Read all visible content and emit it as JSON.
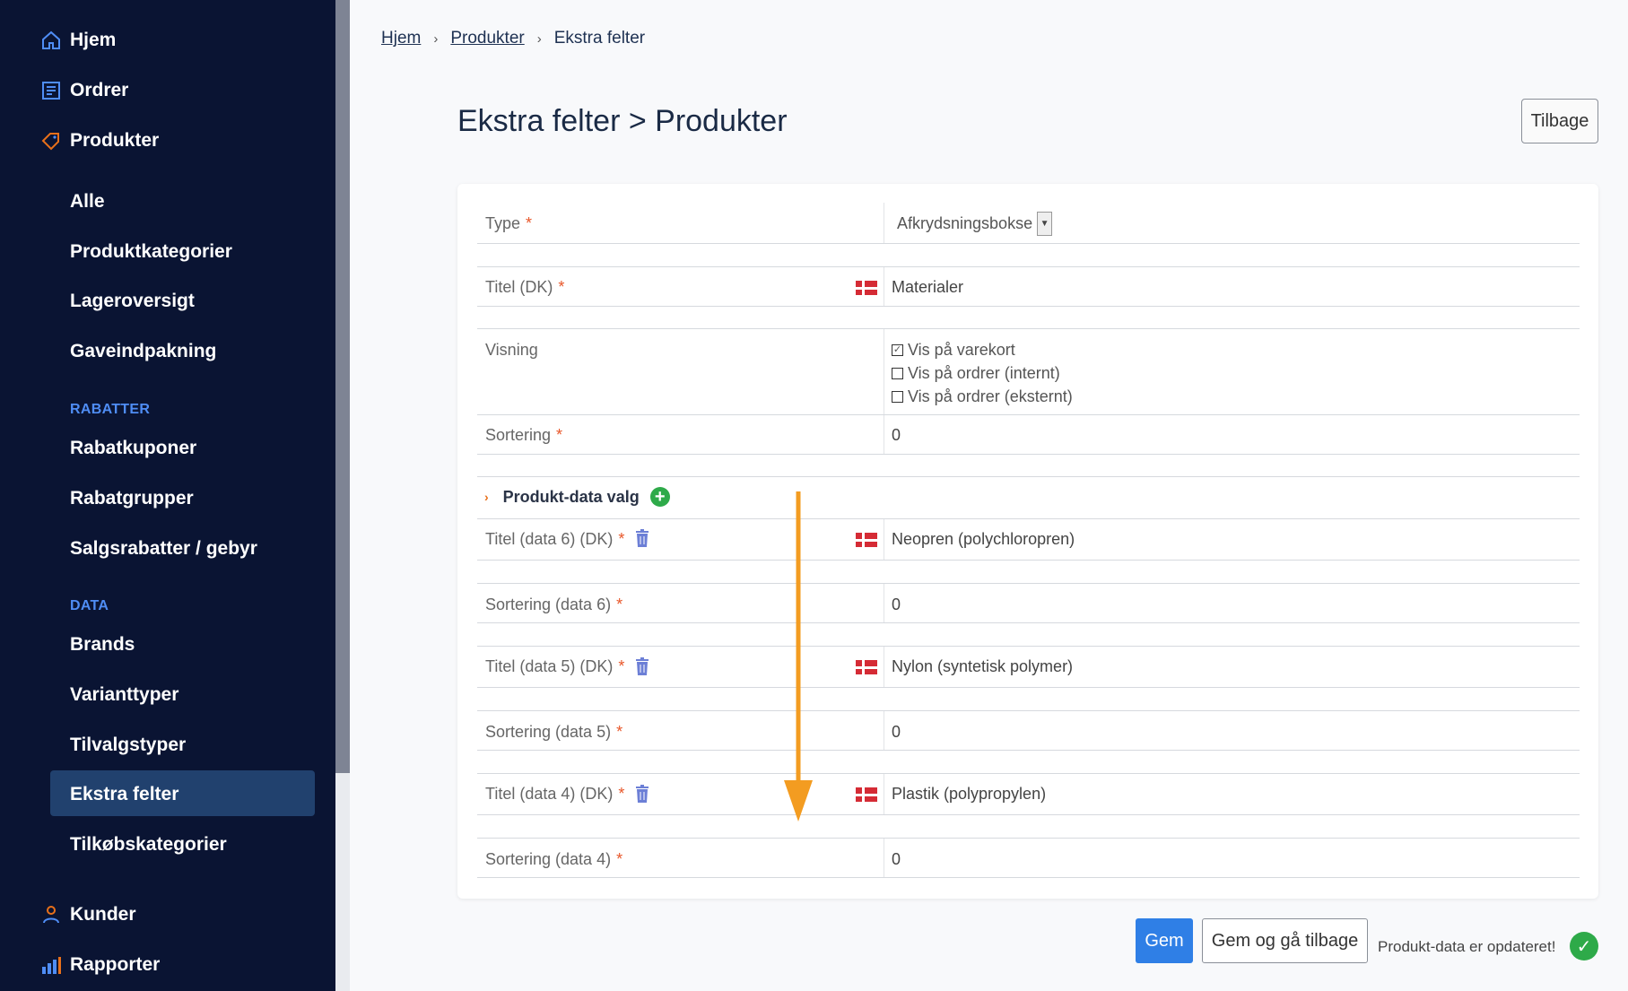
{
  "sidebar": {
    "main_items": [
      {
        "label": "Hjem",
        "icon": "home-icon"
      },
      {
        "label": "Ordrer",
        "icon": "orders-icon"
      },
      {
        "label": "Produkter",
        "icon": "tag-icon"
      }
    ],
    "produkter_sub": [
      "Alle",
      "Produktkategorier",
      "Lageroversigt",
      "Gaveindpakning"
    ],
    "section_rabatter": "RABATTER",
    "rabatter_items": [
      "Rabatkuponer",
      "Rabatgrupper",
      "Salgsrabatter / gebyr"
    ],
    "section_data": "DATA",
    "data_items": [
      "Brands",
      "Varianttyper",
      "Tilvalgstyper",
      "Ekstra felter",
      "Tilkøbskategorier"
    ],
    "bottom_items": [
      {
        "label": "Kunder",
        "icon": "user-icon"
      },
      {
        "label": "Rapporter",
        "icon": "bar-chart-icon"
      }
    ],
    "active_item": "Ekstra felter"
  },
  "breadcrumb": {
    "items": [
      "Hjem",
      "Produkter",
      "Ekstra felter"
    ],
    "separator": "›"
  },
  "header": {
    "title": "Ekstra felter > Produkter",
    "back_label": "Tilbage"
  },
  "form": {
    "type_label": "Type",
    "type_value": "Afkrydsningsbokse",
    "title_label": "Titel (DK)",
    "title_value": "Materialer",
    "visning_label": "Visning",
    "visning_options": [
      {
        "label": "Vis på varekort",
        "checked": true
      },
      {
        "label": "Vis på ordrer (internt)",
        "checked": false
      },
      {
        "label": "Vis på ordrer (eksternt)",
        "checked": false
      }
    ],
    "sort_label": "Sortering",
    "sort_value": "0",
    "required_mark": "*",
    "section_title": "Produkt-data valg",
    "data_rows": [
      {
        "title_label": "Titel (data 6) (DK)",
        "title_value": "Neopren (polychloropren)",
        "sort_label": "Sortering (data 6)",
        "sort_value": "0"
      },
      {
        "title_label": "Titel (data 5) (DK)",
        "title_value": "Nylon (syntetisk polymer)",
        "sort_label": "Sortering (data 5)",
        "sort_value": "0"
      },
      {
        "title_label": "Titel (data 4) (DK)",
        "title_value": "Plastik (polypropylen)",
        "sort_label": "Sortering (data 4)",
        "sort_value": "0"
      }
    ]
  },
  "footer": {
    "save_label": "Gem",
    "save_back_label": "Gem og gå tilbage",
    "status_text": "Produkt-data er opdateret!"
  },
  "colors": {
    "sidebar_bg": "#0a1433",
    "active_bg": "#21416e",
    "section_color": "#4f8df5",
    "primary": "#2f7fe6",
    "required": "#e8572a",
    "success": "#2eaa49",
    "arrow": "#f39c21"
  }
}
